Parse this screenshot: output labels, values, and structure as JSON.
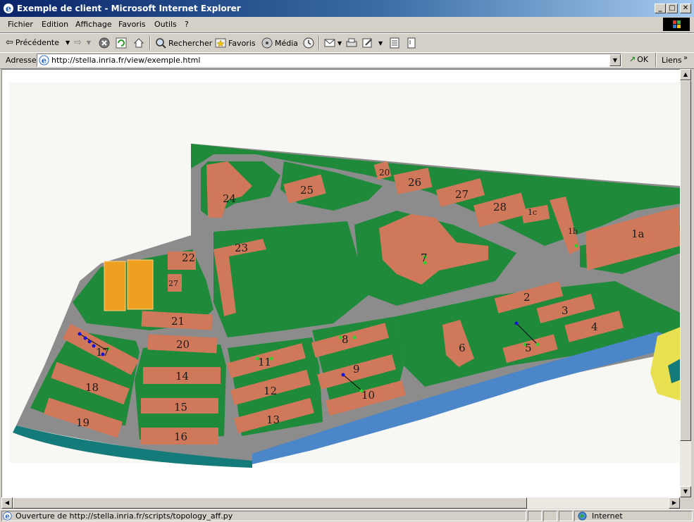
{
  "window": {
    "title": "Exemple de client - Microsoft Internet Explorer",
    "minimize": "_",
    "maximize": "□",
    "close": "✕"
  },
  "menu": {
    "items": [
      "Fichier",
      "Edition",
      "Affichage",
      "Favoris",
      "Outils",
      "?"
    ]
  },
  "toolbar": {
    "back_label": "Précédente",
    "search_label": "Rechercher",
    "favorites_label": "Favoris",
    "media_label": "Média"
  },
  "address": {
    "label": "Adresse",
    "url": "http://stella.inria.fr/view/exemple.html",
    "go_label": "OK",
    "links_label": "Liens"
  },
  "map": {
    "building_labels": [
      "24",
      "25",
      "20",
      "26",
      "27",
      "28",
      "1c",
      "1b",
      "1a",
      "23",
      "7",
      "22",
      "27",
      "21",
      "20",
      "2",
      "3",
      "4",
      "17",
      "8",
      "11",
      "9",
      "10",
      "6",
      "5",
      "14",
      "15",
      "16",
      "18",
      "19",
      "12",
      "13"
    ]
  },
  "status": {
    "text": "Ouverture de http://stella.inria.fr/scripts/topology_aff.py",
    "zone": "Internet"
  },
  "colors": {
    "grass": "#1f8a3a",
    "road": "#8c8c8c",
    "building": "#d0785a",
    "water": "#4a86c8",
    "court": "#f0a020"
  }
}
